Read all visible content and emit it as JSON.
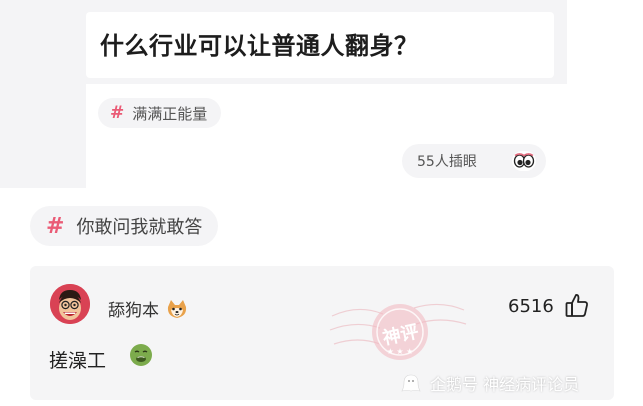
{
  "question": {
    "title": "什么行业可以让普通人翻身？",
    "tag_label": "满满正能量",
    "views_label": "55人插眼"
  },
  "topic": {
    "label": "你敢问我就敢答"
  },
  "comment": {
    "username": "舔狗本",
    "likes": "6516",
    "text": "搓澡工"
  },
  "watermark": {
    "stamp_text": "神评",
    "source": "企鹅号 神经病评论员"
  },
  "colors": {
    "accent": "#ea5b76",
    "card_bg": "#f5f5f6"
  },
  "icons": [
    "hash-icon",
    "eyes-icon",
    "shiba-emoji-icon",
    "thumbs-up-icon",
    "nauseated-face-emoji-icon",
    "penguin-logo-icon"
  ]
}
